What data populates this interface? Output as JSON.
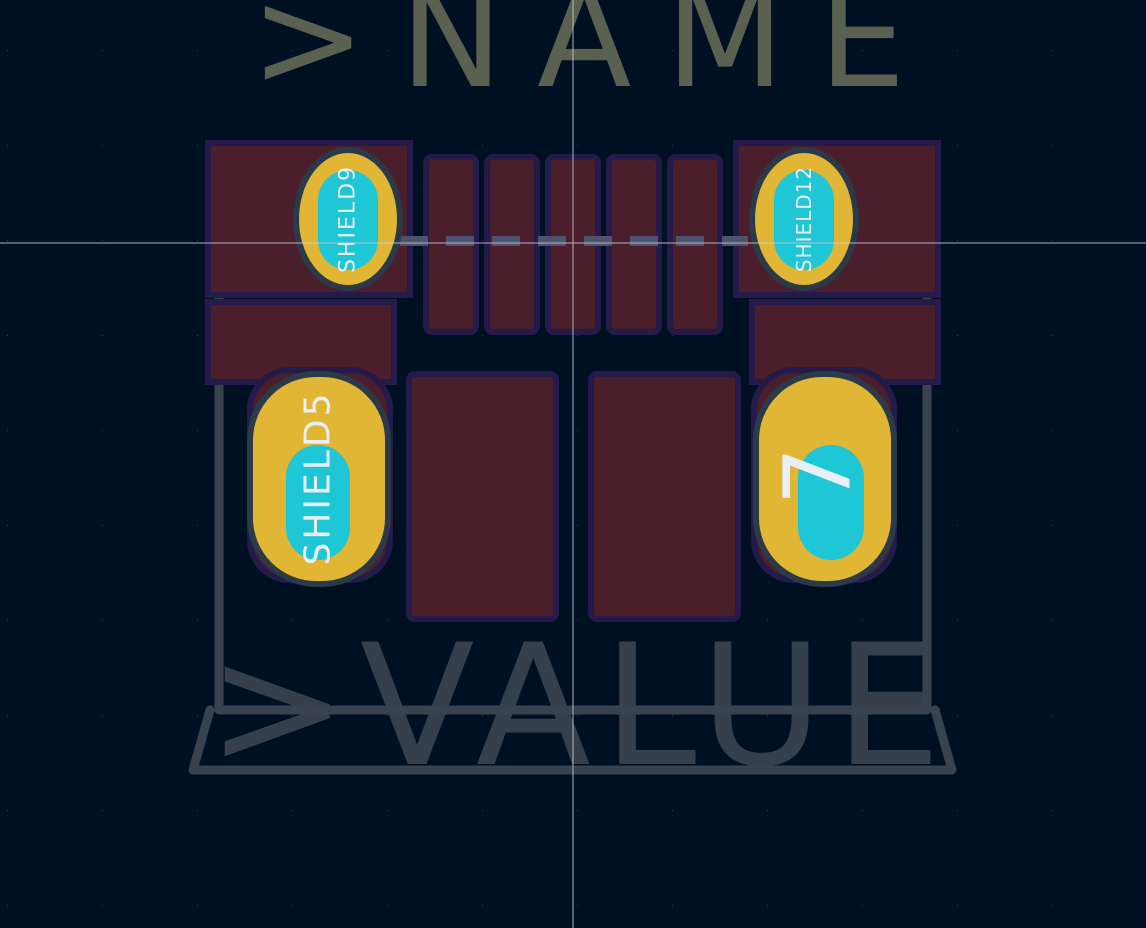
{
  "colors": {
    "background": "#001023",
    "grid_dot": "#3a4a5c",
    "crosshair": "#c8ccd2",
    "silkscreen": "#5b6150",
    "fab_outline": "#39434f",
    "copper_pad": "#4a1e2b",
    "pad_edge": "#241b4a",
    "plated_ring": "#e0b634",
    "drill": "#1ec6d6",
    "pad_label": "#e6f0f6",
    "soldermask_line": "#4e5170"
  },
  "labels": {
    "name_text": ">NAME",
    "value_text": ">VALUE"
  },
  "pads": {
    "shield_top_left": "SHIELD9",
    "shield_top_right": "SHIELD12",
    "shield_bottom_left": "SHIELD5",
    "shield_bottom_right": "7"
  }
}
